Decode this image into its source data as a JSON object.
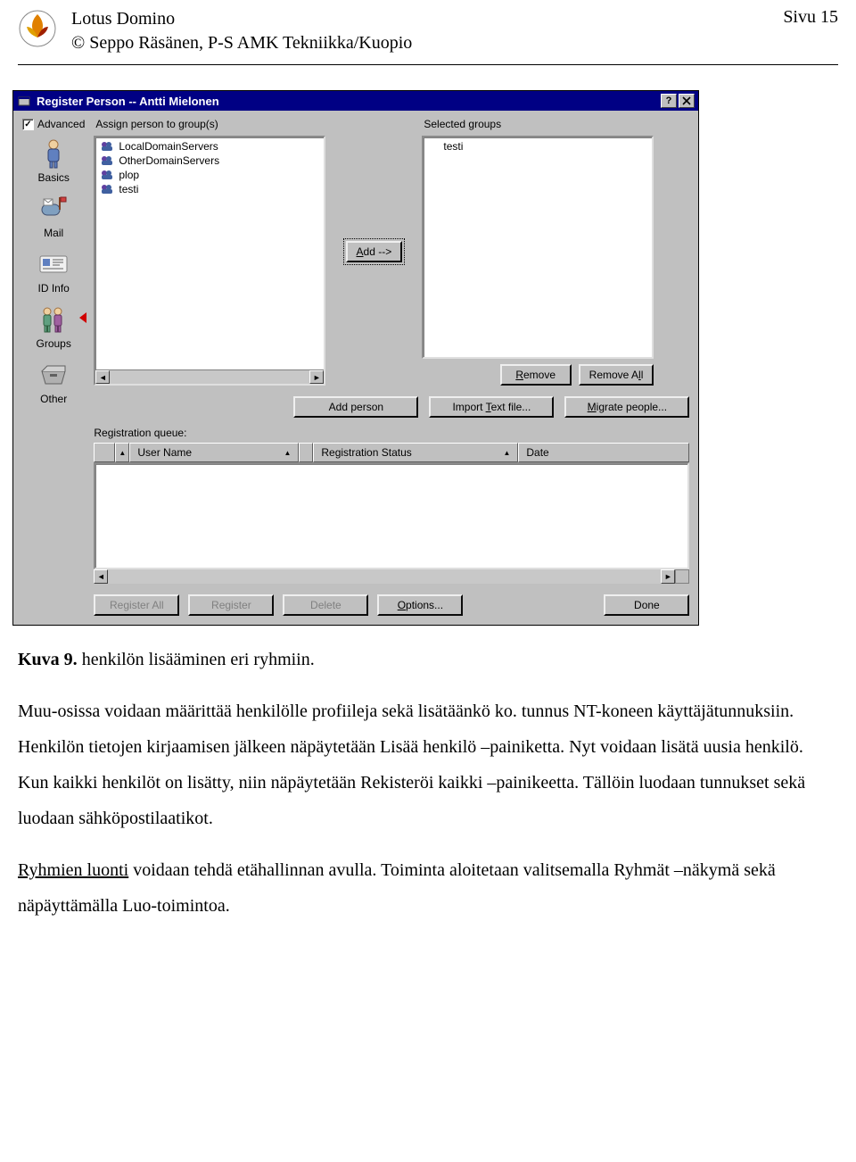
{
  "header": {
    "title": "Lotus Domino",
    "subtitle": "© Seppo Räsänen, P-S AMK Tekniikka/Kuopio",
    "page_label": "Sivu 15"
  },
  "dialog": {
    "title": "Register Person -- Antti Mielonen",
    "advanced_label": "Advanced",
    "nav": {
      "basics": "Basics",
      "mail": "Mail",
      "idinfo": "ID Info",
      "groups": "Groups",
      "other": "Other"
    },
    "labels": {
      "assign": "Assign person to group(s)",
      "selected": "Selected groups",
      "queue": "Registration queue:"
    },
    "available_groups": [
      "LocalDomainServers",
      "OtherDomainServers",
      "plop",
      "testi"
    ],
    "selected_groups": [
      "testi"
    ],
    "buttons": {
      "add": "Add -->",
      "remove": "Remove",
      "remove_all": "Remove All",
      "add_person": "Add person",
      "import_text": "Import Text file...",
      "migrate": "Migrate people...",
      "register_all": "Register All",
      "register": "Register",
      "delete": "Delete",
      "options": "Options...",
      "done": "Done"
    },
    "grid": {
      "col_user": "User Name",
      "col_status": "Registration Status",
      "col_date": "Date"
    }
  },
  "prose": {
    "caption_label": "Kuva 9.",
    "caption_text": "henkilön lisääminen eri ryhmiin.",
    "para1": "Muu-osissa voidaan määrittää henkilölle profiileja sekä lisätäänkö ko. tunnus NT-koneen käyttäjätunnuksiin. Henkilön tietojen kirjaamisen jälkeen näpäytetään Lisää henkilö –painiketta. Nyt voidaan lisätä uusia henkilö. Kun kaikki henkilöt on lisätty, niin näpäytetään Rekisteröi kaikki –painikeetta. Tällöin luodaan tunnukset sekä luodaan sähköpostilaatikot.",
    "para2_lead": "Ryhmien luonti",
    "para2_rest": " voidaan tehdä etähallinnan avulla. Toiminta aloitetaan valitsemalla Ryhmät –näkymä sekä näpäyttämälla Luo-toimintoa."
  }
}
